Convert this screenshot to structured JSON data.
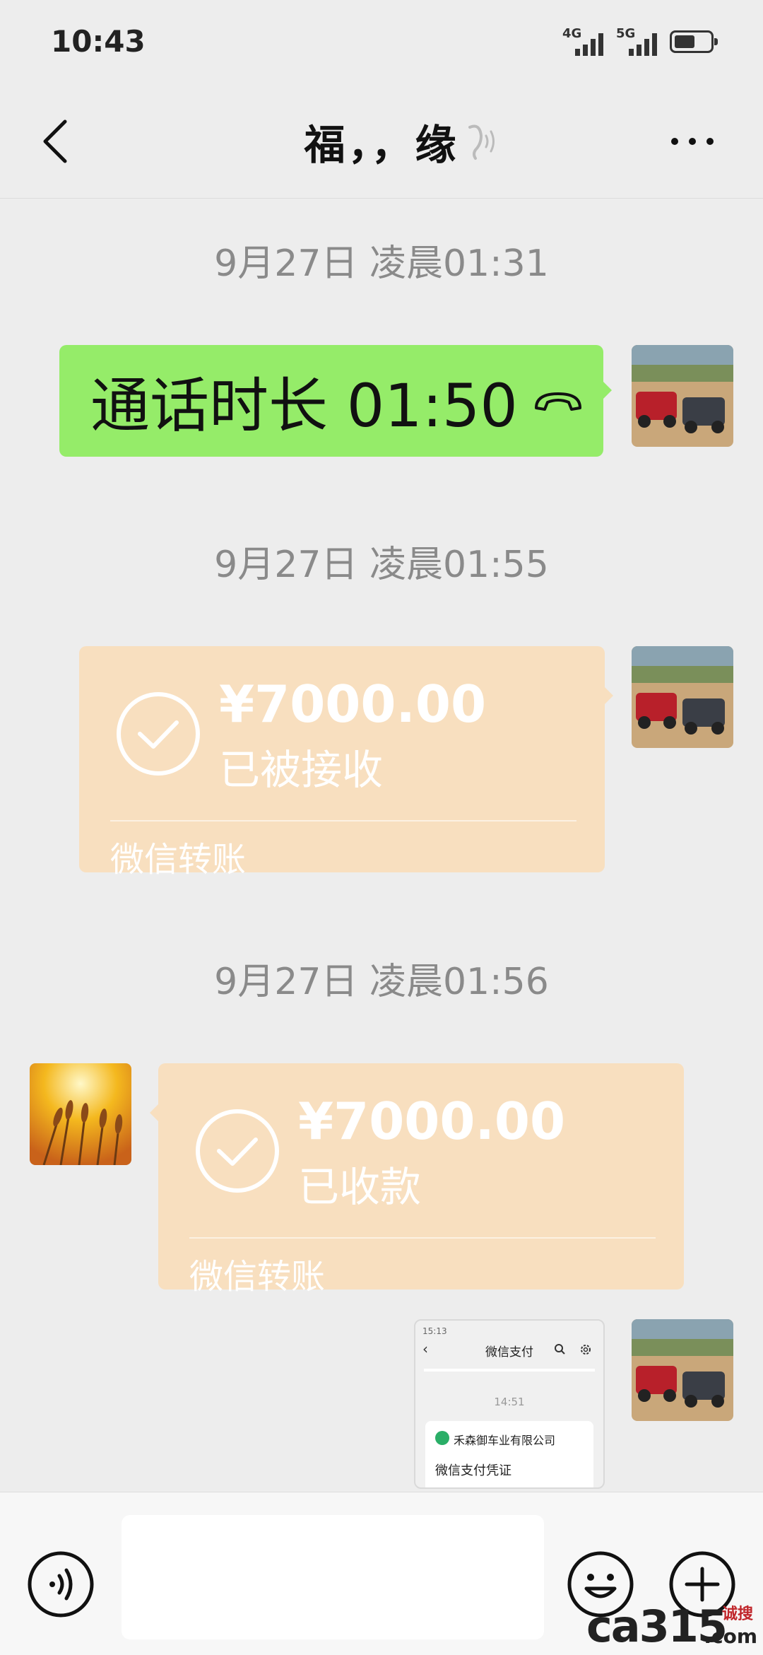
{
  "status_bar": {
    "time": "10:43",
    "signal_1": "4G",
    "signal_2": "5G",
    "battery_level": 0.55
  },
  "nav": {
    "title": "福，，缘",
    "back_icon": "chevron-left-icon",
    "earpiece_icon": "ear-icon",
    "more_icon": "more-icon"
  },
  "messages": [
    {
      "type": "timestamp",
      "text": "9月27日 凌晨01:31"
    },
    {
      "type": "call",
      "side": "right",
      "text": "通话时长 01:50"
    },
    {
      "type": "timestamp",
      "text": "9月27日 凌晨01:55"
    },
    {
      "type": "transfer",
      "side": "right",
      "amount": "¥7000.00",
      "status": "已被接收",
      "footer": "微信转账"
    },
    {
      "type": "timestamp",
      "text": "9月27日 凌晨01:56"
    },
    {
      "type": "transfer",
      "side": "left",
      "amount": "¥7000.00",
      "status": "已收款",
      "footer": "微信转账"
    },
    {
      "type": "image",
      "side": "right",
      "screenshot": {
        "status_time": "15:13",
        "title": "微信支付",
        "time": "14:51",
        "company": "禾森御车业有限公司",
        "voucher": "微信支付凭证"
      }
    }
  ],
  "input_bar": {
    "voice_icon": "voice-icon",
    "emoji_icon": "emoji-icon",
    "plus_icon": "plus-icon",
    "text_value": ""
  },
  "watermark": {
    "main": "ca315",
    "cn": "诚搜",
    "domain": ".com"
  },
  "colors": {
    "background": "#ededed",
    "call_bubble": "#95ec69",
    "transfer_bubble": "#f8dfbf"
  }
}
